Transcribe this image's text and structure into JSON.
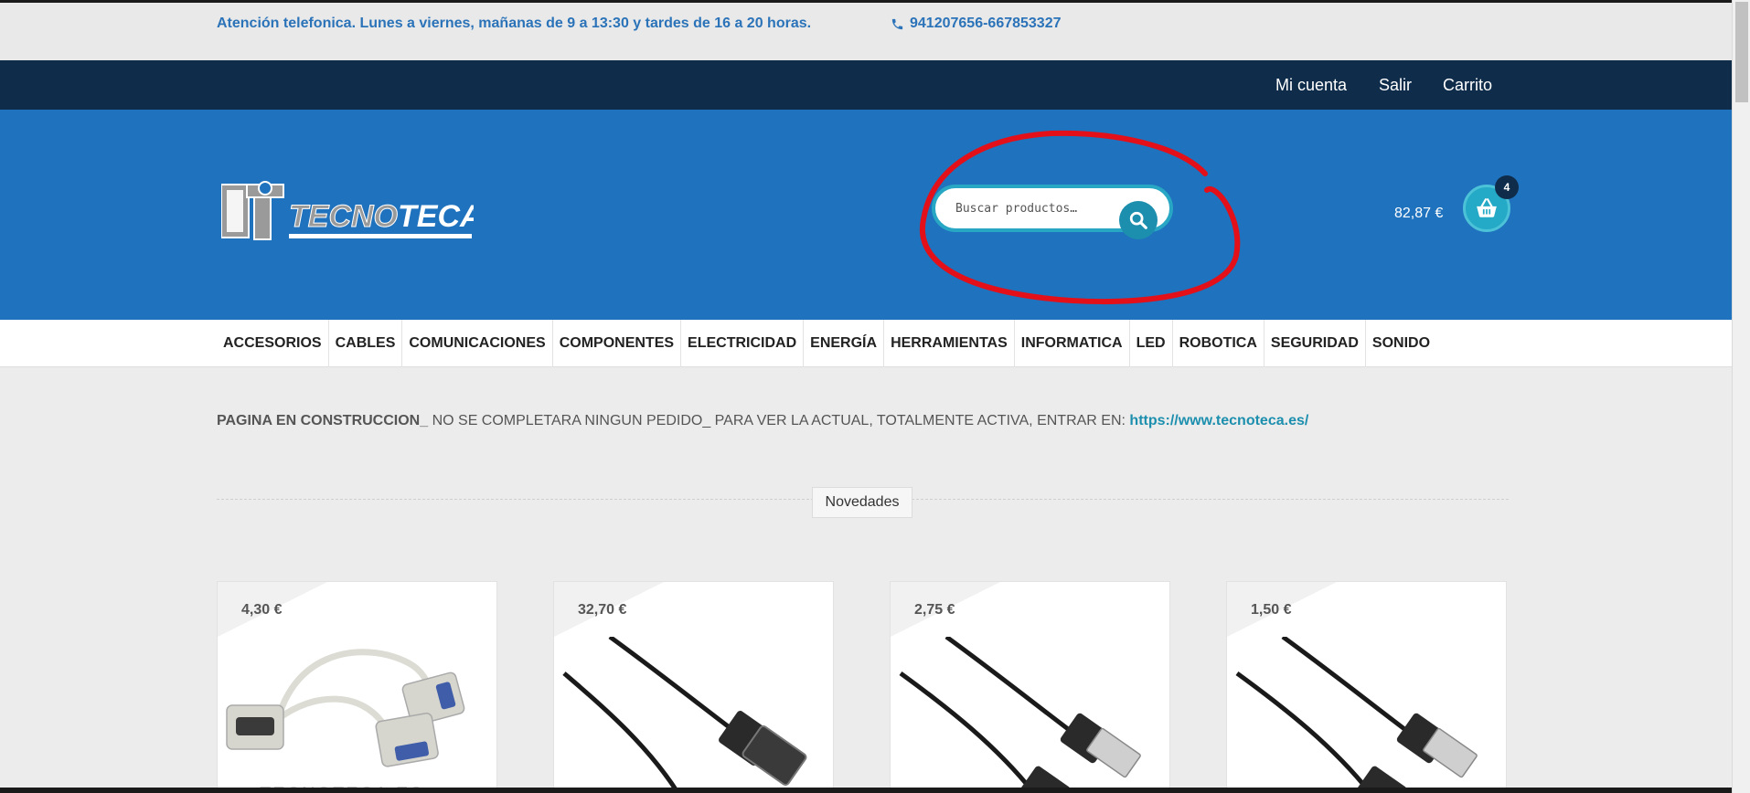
{
  "info_bar": {
    "hours": "Atención telefonica. Lunes a viernes, mañanas de 9 a 13:30 y tardes de 16 a 20 horas.",
    "phone": "941207656-667853327"
  },
  "account_nav": {
    "my_account": "Mi cuenta",
    "logout": "Salir",
    "cart": "Carrito"
  },
  "header": {
    "logo_text_a": "TECNO",
    "logo_text_b": "TECA",
    "search_placeholder": "Buscar productos…",
    "cart_total": "82,87 €",
    "cart_count": "4"
  },
  "categories": [
    "ACCESORIOS",
    "CABLES",
    "COMUNICACIONES",
    "COMPONENTES",
    "ELECTRICIDAD",
    "ENERGÍA",
    "HERRAMIENTAS",
    "INFORMATICA",
    "LED",
    "ROBOTICA",
    "SEGURIDAD",
    "SONIDO"
  ],
  "notice": {
    "strong": "PAGINA EN CONSTRUCCION_",
    "text": " NO SE COMPLETARA NINGUN PEDIDO_ PARA VER LA ACTUAL, TOTALMENTE ACTIVA, ENTRAR EN: ",
    "link": "https://www.tecnoteca.es/"
  },
  "section": {
    "title": "Novedades"
  },
  "products": [
    {
      "price": "4,30 €",
      "watermark": "TECNOTECA.ES"
    },
    {
      "price": "32,70 €"
    },
    {
      "price": "2,75 €"
    },
    {
      "price": "1,50 €"
    }
  ],
  "colors": {
    "brand_blue": "#1f72bd",
    "navy": "#0f2d4b",
    "accent_teal": "#28a7c4",
    "annotation_red": "#e3101a"
  }
}
